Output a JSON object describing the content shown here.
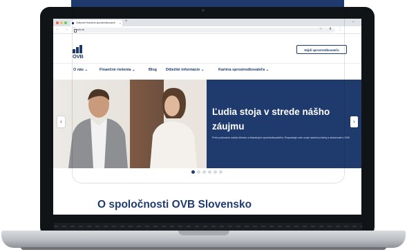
{
  "browser": {
    "tab_title": "Odborné finančné sprostredkovanie",
    "tab_close": "×",
    "new_tab": "+",
    "tab_dropdown": "⌄",
    "url": "ovb.sk",
    "nav_icons": "← → ↻",
    "ext_icons": "☆ ⬇ ⋮",
    "window_dots": [
      "#ee5f57",
      "#f4bd4f",
      "#5ecd58"
    ]
  },
  "site": {
    "logo_text": "OVB",
    "cta_label": "Nájdi sprostredkovateľa",
    "nav": [
      {
        "label": "O nás ⌄"
      },
      {
        "label": "Finančné riešenia ⌄"
      },
      {
        "label": "Blog"
      },
      {
        "label": "Dôležité informácie ⌄"
      },
      {
        "label": "Kariéra sprostredkovateľa ⌄"
      }
    ],
    "hero": {
      "title": "Ľudia stoja v strede nášho záujmu",
      "subtitle": "Preto počúvame našich klientov a finančných sprostredkovateľov. Rozprávajú nám svoje osobné príbehy a skúsenosti s OVB.",
      "prev_arrow": "‹",
      "next_arrow": "›",
      "slides": 6,
      "active_slide": 1
    },
    "section_title": "O spoločnosti OVB Slovensko"
  },
  "colors": {
    "brand": "#1f3b6d"
  }
}
